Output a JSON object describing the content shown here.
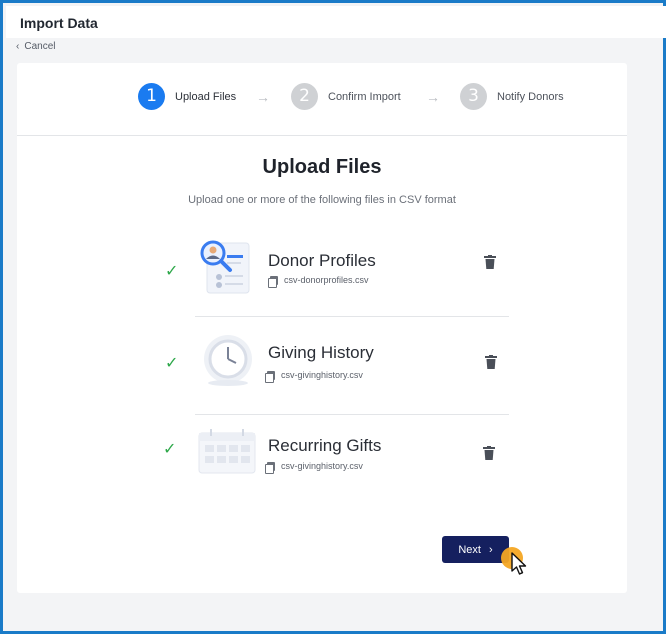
{
  "window": {
    "title": "Import Data"
  },
  "nav": {
    "cancel_label": "Cancel",
    "cancel_icon": "chevron-left-icon"
  },
  "stepper": {
    "steps": [
      {
        "number": "1",
        "label": "Upload Files",
        "state": "active"
      },
      {
        "number": "2",
        "label": "Confirm Import",
        "state": "inactive"
      },
      {
        "number": "3",
        "label": "Notify Donors",
        "state": "inactive"
      }
    ],
    "separator_glyph": "→"
  },
  "main": {
    "heading": "Upload Files",
    "subheading": "Upload one or more of the following files in CSV format",
    "files": [
      {
        "name": "Donor Profiles",
        "filename": "csv-donorprofiles.csv",
        "status_icon": "check-icon",
        "thumb_icon": "profile-search-icon"
      },
      {
        "name": "Giving History",
        "filename": "csv-givinghistory.csv",
        "status_icon": "check-icon",
        "thumb_icon": "clock-icon"
      },
      {
        "name": "Recurring Gifts",
        "filename": "csv-givinghistory.csv",
        "status_icon": "check-icon",
        "thumb_icon": "calendar-icon"
      }
    ],
    "next_label": "Next"
  },
  "colors": {
    "accent": "#1a7bf0",
    "primary_button": "#15205f",
    "success": "#2ea84a",
    "frame_border": "#1a7bc8",
    "cursor_highlight": "#f4a623"
  }
}
